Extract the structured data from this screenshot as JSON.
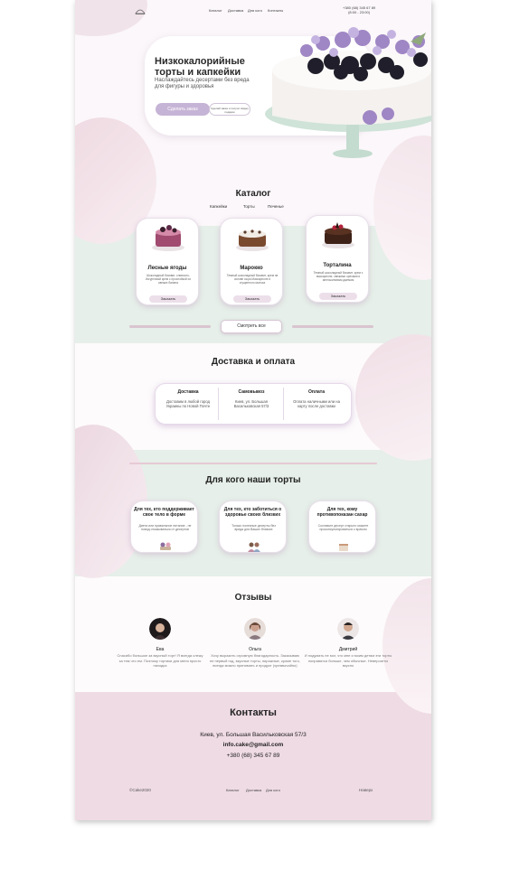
{
  "header": {
    "nav": [
      "Каталог",
      "Доставка",
      "Для кого",
      "Контакты"
    ],
    "phone": "+380 (68) 345 67 89",
    "hours": "(8:00 - 23:00)"
  },
  "hero": {
    "title_line1": "Низкокалорийные",
    "title_line2": "торты и капкейки",
    "subtitle": "Наслаждайтесь десертами без вреда для фигуры и здоровья",
    "order_button": "Сделать заказ",
    "order_note": "Сделай заказ и получи скидку подарок"
  },
  "catalog": {
    "title": "Каталог",
    "tabs": [
      "Капкейки",
      "Торты",
      "Печенье"
    ],
    "items": [
      {
        "name": "Лесные ягоды",
        "desc": "Шоколадный бисквит, сливочно-йогуртовый крем с прослойкой из свежих банана",
        "button": "Заказать"
      },
      {
        "name": "Марокко",
        "desc": "Темный шоколадный бисквит, крем на основе сыра Маскарпоне и сгущенного молока",
        "button": "Заказать"
      },
      {
        "name": "Торталина",
        "desc": "Темный шоколадный бисквит, крем с маскарпоне, свежими орехами и апельсиновым джемом",
        "button": "Заказать"
      }
    ],
    "see_all": "Смотреть все"
  },
  "delivery": {
    "title": "Доставка и оплата",
    "columns": [
      {
        "title": "Доставка",
        "text": "Доставим в любой город Украины по Новой Почте"
      },
      {
        "title": "Самовывоз",
        "text": "Киев, ул. Большая Васильковская 57/3"
      },
      {
        "title": "Оплата",
        "text": "Оплата наличными или на карту после доставки"
      }
    ]
  },
  "audience": {
    "title": "Для кого наши торты",
    "cards": [
      {
        "title": "Для тех, кто поддерживает свое тело в форме",
        "text": "Диета или правильное питание - не повод отказываться от десертов"
      },
      {
        "title": "Для тех, кто заботиться о здоровье своих близких",
        "text": "Только полезные десерты без вреда для Ваших близких"
      },
      {
        "title": "Для тех, кому противопоказан сахар",
        "text": "Составьте десерт открыто можете проконсультироваться с врачом"
      }
    ]
  },
  "reviews": {
    "title": "Отзывы",
    "items": [
      {
        "name": "Ева",
        "text": "Спасибо большое за вкусный торт! Я всегда слежу за тем что ем. Поэтому тортики для меня просто находка"
      },
      {
        "name": "Ольга",
        "text": "Хочу выразить огромную благодарность. Заказываю не первый год, вкусные торты, пирожные, кроме того, всегда можно принимать и продукт (чрезвычайно)"
      },
      {
        "name": "Дмитрий",
        "text": "И подумать не мог, что мне и моим детям эти торты понравятся больше, чем обычные. Невероятно вкусно"
      }
    ]
  },
  "contacts": {
    "title": "Контакты",
    "address": "Киев, ул. Большая Васильковская 57/3",
    "email": "info.cake@gmail.com",
    "phone": "+380 (68) 345 67 89"
  },
  "footer": {
    "copyright": "©Cake2020",
    "links": [
      "Каталог",
      "Доставка",
      "Для кого"
    ],
    "up": "Наверх"
  },
  "colors": {
    "accent": "#c6b4d6",
    "pink_blob": "#efdde3",
    "mint": "#e5efe9",
    "contacts_bg": "#eed9e2"
  }
}
